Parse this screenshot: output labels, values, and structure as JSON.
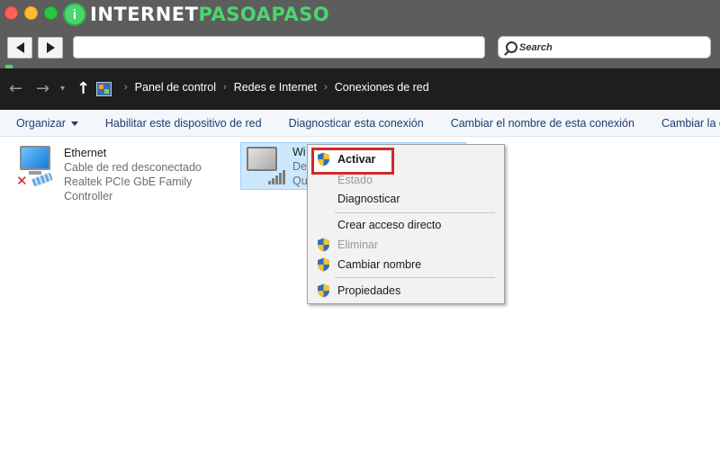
{
  "logo": {
    "part_a": "INTERNET",
    "part_b": "PASOAPASO",
    "mark": "i"
  },
  "browser": {
    "url_value": "",
    "search_placeholder": "Search"
  },
  "explorer": {
    "breadcrumb": [
      "Panel de control",
      "Redes e Internet",
      "Conexiones de red"
    ],
    "commands": [
      "Organizar",
      "Habilitar este dispositivo de red",
      "Diagnosticar esta conexión",
      "Cambiar el nombre de esta conexión",
      "Cambiar la configu"
    ],
    "connections": {
      "ethernet": {
        "name": "Ethernet",
        "status": "Cable de red desconectado",
        "adapter": "Realtek PCIe GbE Family Controller"
      },
      "wifi": {
        "name": "Wi",
        "status": "De",
        "adapter": "Qu"
      }
    }
  },
  "context_menu": {
    "items": [
      {
        "label": "Activar",
        "shield": true,
        "disabled": false,
        "bold": true
      },
      {
        "label": "Estado",
        "shield": false,
        "disabled": true,
        "bold": false
      },
      {
        "label": "Diagnosticar",
        "shield": false,
        "disabled": false,
        "bold": false
      },
      {
        "label": "Crear acceso directo",
        "shield": false,
        "disabled": false,
        "bold": false
      },
      {
        "label": "Eliminar",
        "shield": true,
        "disabled": true,
        "bold": false
      },
      {
        "label": "Cambiar nombre",
        "shield": true,
        "disabled": false,
        "bold": false
      },
      {
        "label": "Propiedades",
        "shield": true,
        "disabled": false,
        "bold": false
      }
    ]
  },
  "colors": {
    "highlight_border": "#d22a2a",
    "selection_bg": "#cce8ff",
    "brand_green": "#4ad66d"
  }
}
